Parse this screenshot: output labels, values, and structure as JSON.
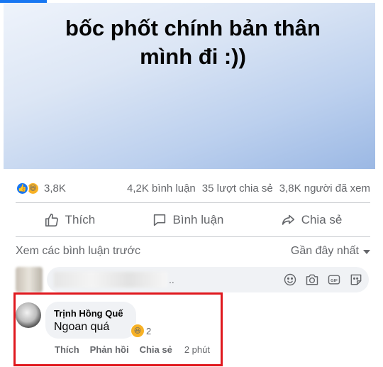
{
  "post": {
    "caption_line1": "bốc phốt chính bản thân",
    "caption_line2": "mình đi :))"
  },
  "stats": {
    "reactions_count": "3,8K",
    "comments": "4,2K bình luận",
    "shares": "35 lượt chia sẻ",
    "views": "3,8K người đã xem"
  },
  "actions": {
    "like": "Thích",
    "comment": "Bình luận",
    "share": "Chia sẻ"
  },
  "comments_header": {
    "view_previous": "Xem các bình luận trước",
    "sort": "Gần đây nhất"
  },
  "composer": {
    "placeholder_suffix": ".."
  },
  "comment": {
    "author": "Trịnh Hồng Quế",
    "text": "Ngoan quá",
    "reaction_count": "2",
    "like": "Thích",
    "reply": "Phản hồi",
    "share": "Chia sẻ",
    "time": "2 phút"
  },
  "colors": {
    "accent": "#1877f2",
    "highlight_border": "#e0181e",
    "secondary_text": "#65676b"
  },
  "icons": [
    "like-icon",
    "haha-icon",
    "comment-icon",
    "share-icon",
    "emoji-icon",
    "camera-icon",
    "gif-icon",
    "sticker-icon",
    "dropdown-caret-icon"
  ]
}
